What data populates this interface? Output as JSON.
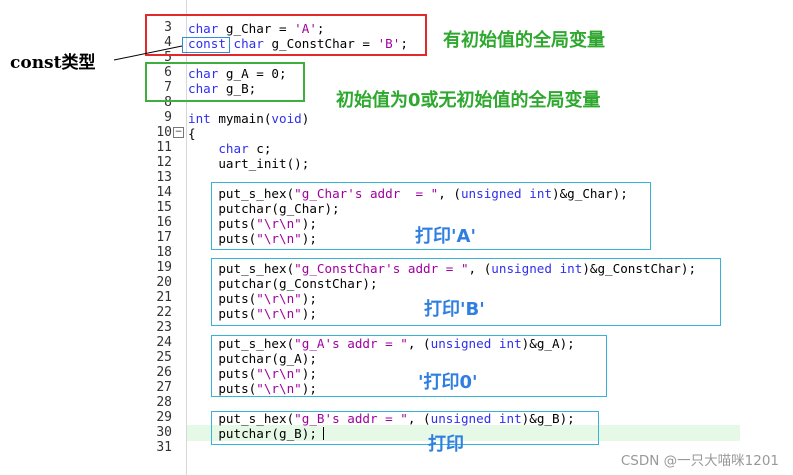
{
  "labels": {
    "const_type": "const类型",
    "initialized_globals": "有初始值的全局变量",
    "zero_or_no_init_globals": "初始值为0或无初始值的全局变量",
    "print_A": "打印'A'",
    "print_B": "打印'B'",
    "print_0": "'打印0'",
    "print": "打印"
  },
  "watermark": "CSDN @一只大喵咪1201",
  "colors": {
    "red_box": "#e22828",
    "green_box": "#3fae3f",
    "blue_box": "#36b3d6",
    "keyword": "#2f2ff0",
    "string": "#a000a0"
  },
  "code": {
    "lines": [
      {
        "n": "3",
        "text": "char g_Char = 'A';"
      },
      {
        "n": "4",
        "text": "const char g_ConstChar = 'B';"
      },
      {
        "n": "5",
        "text": ""
      },
      {
        "n": "6",
        "text": "char g_A = 0;"
      },
      {
        "n": "7",
        "text": "char g_B;"
      },
      {
        "n": "8",
        "text": ""
      },
      {
        "n": "9",
        "text": "int mymain(void)"
      },
      {
        "n": "10",
        "text": "{"
      },
      {
        "n": "11",
        "text": "    char c;"
      },
      {
        "n": "12",
        "text": "    uart_init();"
      },
      {
        "n": "13",
        "text": ""
      },
      {
        "n": "14",
        "text": "    put_s_hex(\"g_Char's addr  = \", (unsigned int)&g_Char);"
      },
      {
        "n": "15",
        "text": "    putchar(g_Char);"
      },
      {
        "n": "16",
        "text": "    puts(\"\\r\\n\");"
      },
      {
        "n": "17",
        "text": "    puts(\"\\r\\n\");"
      },
      {
        "n": "18",
        "text": ""
      },
      {
        "n": "19",
        "text": "    put_s_hex(\"g_ConstChar's addr = \", (unsigned int)&g_ConstChar);"
      },
      {
        "n": "20",
        "text": "    putchar(g_ConstChar);"
      },
      {
        "n": "21",
        "text": "    puts(\"\\r\\n\");"
      },
      {
        "n": "22",
        "text": "    puts(\"\\r\\n\");"
      },
      {
        "n": "23",
        "text": ""
      },
      {
        "n": "24",
        "text": "    put_s_hex(\"g_A's addr = \", (unsigned int)&g_A);"
      },
      {
        "n": "25",
        "text": "    putchar(g_A);"
      },
      {
        "n": "26",
        "text": "    puts(\"\\r\\n\");"
      },
      {
        "n": "27",
        "text": "    puts(\"\\r\\n\");"
      },
      {
        "n": "28",
        "text": ""
      },
      {
        "n": "29",
        "text": "    put_s_hex(\"g_B's addr = \", (unsigned int)&g_B);"
      },
      {
        "n": "30",
        "text": "    putchar(g_B);"
      },
      {
        "n": "31",
        "text": ""
      }
    ]
  }
}
